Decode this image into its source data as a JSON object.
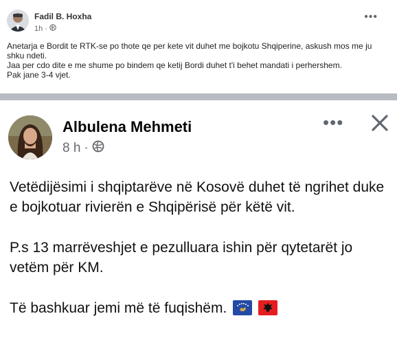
{
  "top_post": {
    "author": "Fadil B. Hoxha",
    "time": "1h",
    "more_label": "•••",
    "paragraph_1": "Anetarja e Bordit te RTK-se po thote qe per kete vit duhet me bojkotu Shqiperine, askush mos me ju shku ndeti.",
    "paragraph_2": "Jaa per cdo dite e me shume po bindem qe ketij Bordi duhet t'i behet mandati i perhershem.",
    "paragraph_3": "Pak jane 3-4 vjet."
  },
  "shared_post": {
    "author": "Albulena Mehmeti",
    "time": "8 h",
    "more_label": "•••",
    "paragraph_1": "Vetëdijësimi i shqiptarëve në Kosovë duhet të ngrihet duke e bojkotuar rivierën e Shqipërisë për këtë vit.",
    "paragraph_2": "P.s 13 marrëveshjet e pezulluara ishin për qytetarët jo vetëm për KM.",
    "paragraph_3": "Të bashkuar jemi më të fuqishëm."
  },
  "icons": {
    "privacy": "globe-icon",
    "more": "more-options-icon",
    "close": "close-icon",
    "flag_1": "kosovo-flag-icon",
    "flag_2": "albania-flag-icon"
  },
  "colors": {
    "meta_text": "#65676b",
    "divider": "#b8bcc2",
    "kosovo_blue": "#244AA5",
    "albania_red": "#E41E20"
  }
}
